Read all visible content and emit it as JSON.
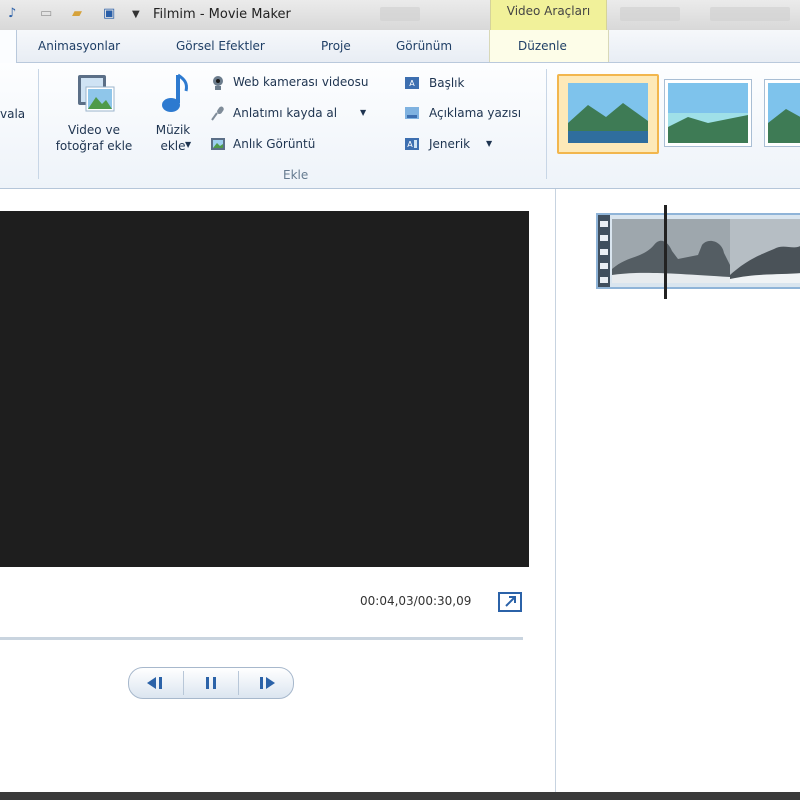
{
  "window": {
    "title": "Filmim - Movie Maker",
    "context_tab": "Video Araçları"
  },
  "tabs": [
    "Animasyonlar",
    "Görsel Efektler",
    "Proje",
    "Görünüm",
    "Düzenle"
  ],
  "ribbon": {
    "partial_left_label": "vala",
    "add_video_label": "Video ve\nfotoğraf ekle",
    "add_music_label": "Müzik\nekle",
    "webcam_label": "Web kamerası videosu",
    "narration_label": "Anlatımı kayda al",
    "snapshot_label": "Anlık Görüntü",
    "title_label": "Başlık",
    "caption_label": "Açıklama yazısı",
    "credits_label": "Jenerik",
    "group_label": "Ekle"
  },
  "preview": {
    "timecode": "00:04,03/00:30,09"
  },
  "icons": {
    "video": "film-photo-icon",
    "music": "music-note-icon",
    "webcam": "webcam-icon",
    "narration": "microphone-icon",
    "snapshot": "snapshot-icon",
    "title": "title-icon",
    "caption": "caption-icon",
    "credits": "credits-icon",
    "fullscreen": "fullscreen-icon",
    "prev": "previous-frame-icon",
    "pause": "pause-icon",
    "next": "next-frame-icon"
  },
  "colors": {
    "accent": "#2b62a8",
    "context_tab": "#f1f19a",
    "selected_theme": "#f2b64d",
    "screen": "#1e1e1e"
  }
}
